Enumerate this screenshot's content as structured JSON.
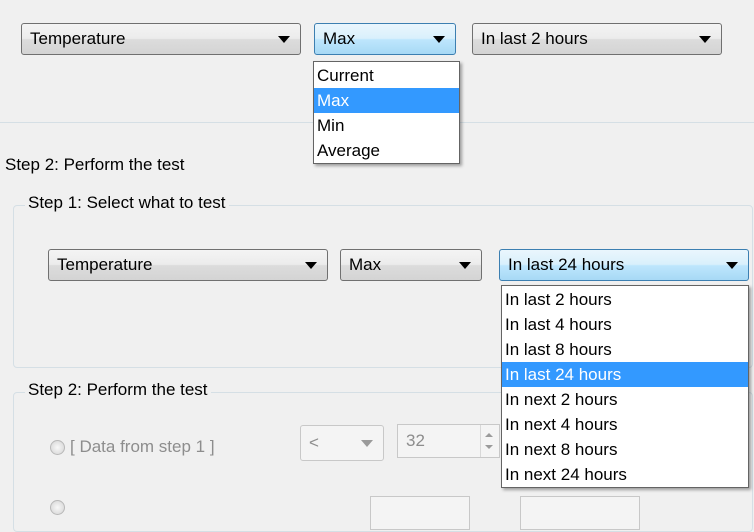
{
  "top": {
    "metric_combo": "Temperature",
    "stat_combo": "Max",
    "range_combo": "In last 2 hours",
    "stat_options": [
      "Current",
      "Max",
      "Min",
      "Average"
    ],
    "stat_selected_index": 1
  },
  "labels": {
    "outer_step2": "Step 2: Perform the test",
    "step1_legend": "Step 1: Select what to test",
    "step2_legend": "Step 2: Perform the test"
  },
  "step1": {
    "metric_combo": "Temperature",
    "stat_combo": "Max",
    "range_combo": "In last 24 hours",
    "range_options": [
      "In last 2 hours",
      "In last 4 hours",
      "In last 8 hours",
      "In last 24 hours",
      "In next 2 hours",
      "In next 4 hours",
      "In next 8 hours",
      "In next 24 hours"
    ],
    "range_selected_index": 3
  },
  "step2": {
    "row1_label": "[ Data from step 1 ]",
    "row1_operator": "<",
    "row1_value": "32"
  },
  "colors": {
    "selection": "#3399ff",
    "window_bg": "#f0f0f0",
    "group_border": "#d5dfe5"
  }
}
